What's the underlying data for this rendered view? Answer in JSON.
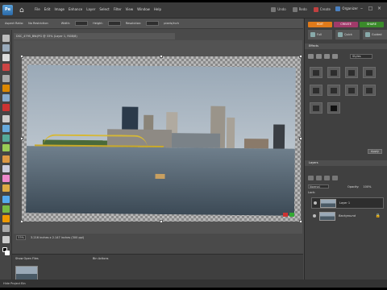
{
  "menubar": {
    "items": [
      "File",
      "Edit",
      "Image",
      "Enhance",
      "Layer",
      "Select",
      "Filter",
      "View",
      "Window",
      "Help"
    ],
    "undo": "Undo",
    "redo": "Redo",
    "create": "Create",
    "organizer": "Organizer"
  },
  "optbar": {
    "label1": "Aspect Ratio:",
    "value1": "No Restriction",
    "width_label": "Width:",
    "height_label": "Height:",
    "resolution_label": "Resolution:",
    "resolution_unit": "pixels/inch"
  },
  "document": {
    "tab_title": "DSC_4795_BW.JPG @ 33% (Layer 1, RGB/8)"
  },
  "status": {
    "zoom": "33%",
    "info": "3.216 inches x 2.147 inches (300 ppi)"
  },
  "projbin": {
    "title": "Show Open Files",
    "option": "Bin Actions"
  },
  "bottombar": {
    "label": "Hide Project Bin"
  },
  "rpanel": {
    "mode_tabs": [
      {
        "label": "EDIT",
        "color": "#e07a1a"
      },
      {
        "label": "CREATE",
        "color": "#a03a6a"
      },
      {
        "label": "SHARE",
        "color": "#3a8a2a"
      }
    ],
    "sub_tabs": [
      "Full",
      "Quick",
      "Guided"
    ],
    "effects_header": "Effects",
    "effects_select": "Styles",
    "apply_label": "Apply",
    "layers_header": "Layers",
    "blend_mode": "Normal",
    "opacity_label": "Opacity:",
    "opacity_value": "100%",
    "lock_label": "Lock:",
    "layers": [
      {
        "name": "Layer 1",
        "selected": true
      },
      {
        "name": "Background",
        "selected": false
      }
    ]
  },
  "colors": {
    "app_bg": "#4a4a4a",
    "panel_bg": "#404040",
    "edit_tab": "#e07a1a",
    "create_tab": "#a03a6a",
    "share_tab": "#3a8a2a",
    "bridge": "#d6b836"
  }
}
